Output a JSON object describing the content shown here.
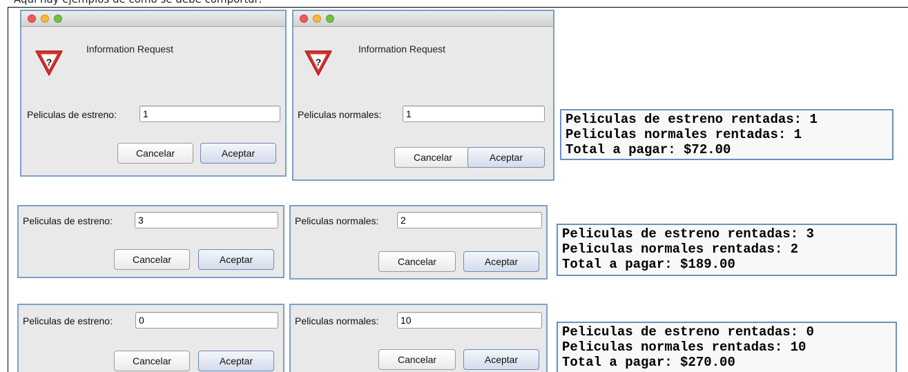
{
  "intro_text": "Aquí hay ejemplos de como se debe comportar:",
  "dialog_title": "Information Request",
  "buttons": {
    "cancel": "Cancelar",
    "accept": "Aceptar"
  },
  "examples": [
    {
      "estreno_label": "Peliculas de estreno:",
      "estreno_value": "1",
      "normales_label": "Peliculas normales:",
      "normales_value": "1",
      "output": [
        "Peliculas de estreno rentadas: 1",
        "Peliculas normales rentadas: 1",
        "Total a pagar: $72.00"
      ]
    },
    {
      "estreno_label": "Peliculas de estreno:",
      "estreno_value": "3",
      "normales_label": "Peliculas normales:",
      "normales_value": "2",
      "output": [
        "Peliculas de estreno rentadas: 3",
        "Peliculas normales rentadas: 2",
        "Total a pagar: $189.00"
      ]
    },
    {
      "estreno_label": "Peliculas de estreno:",
      "estreno_value": "0",
      "normales_label": "Peliculas normales:",
      "normales_value": "10",
      "output": [
        "Peliculas de estreno rentadas: 0",
        "Peliculas normales rentadas: 10",
        "Total a pagar: $270.00"
      ]
    }
  ],
  "colors": {
    "dialog_border": "#7c9fc7",
    "output_border": "#6a8fc0",
    "warning_red": "#d9302c"
  },
  "icons": {
    "warning": "question-warning-triangle-icon",
    "close": "close-light-icon",
    "minimize": "minimize-light-icon",
    "zoom": "zoom-light-icon"
  }
}
